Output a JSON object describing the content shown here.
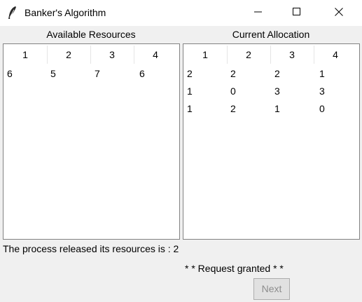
{
  "window": {
    "title": "Banker's Algorithm",
    "icon": "feather-icon",
    "controls": [
      "minimize-icon",
      "maximize-icon",
      "close-icon"
    ]
  },
  "available": {
    "label": "Available Resources",
    "columns": [
      "1",
      "2",
      "3",
      "4"
    ],
    "rows": [
      [
        "6",
        "5",
        "7",
        "6"
      ]
    ]
  },
  "allocation": {
    "label": "Current Allocation",
    "columns": [
      "1",
      "2",
      "3",
      "4"
    ],
    "rows": [
      [
        "2",
        "2",
        "2",
        "1"
      ],
      [
        "1",
        "0",
        "3",
        "3"
      ],
      [
        "1",
        "2",
        "1",
        "0"
      ]
    ]
  },
  "status": {
    "released_text": "The process released its resources is : 2",
    "granted_text": "* * Request granted * *"
  },
  "buttons": {
    "next_label": "Next",
    "next_enabled": false
  }
}
